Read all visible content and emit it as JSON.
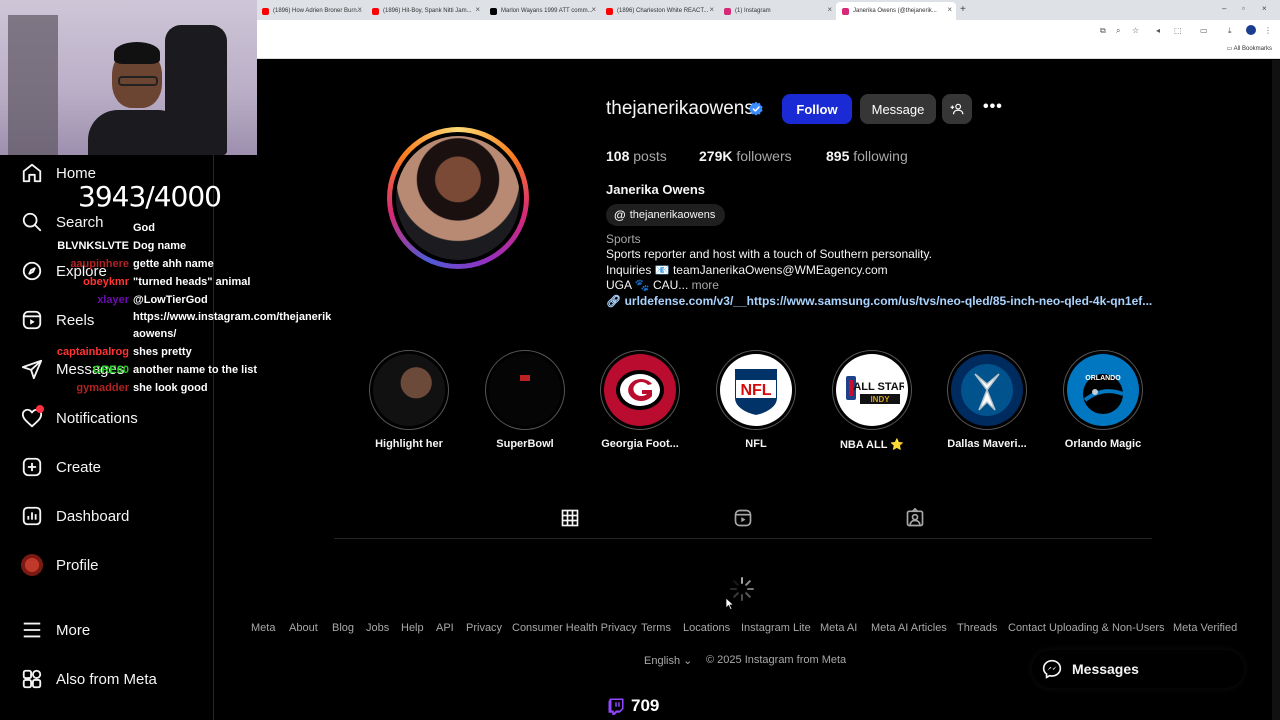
{
  "browser": {
    "tabs": [
      {
        "label": "(1896) How Adrien Broner Burn...",
        "color": "#ff0000"
      },
      {
        "label": "(1896) Hit-Boy, Spank Nitti Jam...",
        "color": "#ff0000"
      },
      {
        "label": "Marlon Wayans 1999 ATT comm...",
        "color": "#000000"
      },
      {
        "label": "(1896) Charleston White REACT...",
        "color": "#ff0000"
      },
      {
        "label": "(1) Instagram",
        "color": "#d62976"
      },
      {
        "label": "Janerika Owens (@thejanerik...",
        "color": "#d62976"
      }
    ],
    "bookmarks_label": "All Bookmarks"
  },
  "sidebar": {
    "items": [
      {
        "label": "Home",
        "icon": "home-icon"
      },
      {
        "label": "Search",
        "icon": "search-icon"
      },
      {
        "label": "Explore",
        "icon": "compass-icon"
      },
      {
        "label": "Reels",
        "icon": "reels-icon"
      },
      {
        "label": "Messages",
        "icon": "send-icon"
      },
      {
        "label": "Notifications",
        "icon": "heart-icon"
      },
      {
        "label": "Create",
        "icon": "plus-square-icon"
      },
      {
        "label": "Dashboard",
        "icon": "dashboard-icon"
      },
      {
        "label": "Profile",
        "icon": "avatar"
      },
      {
        "label": "More",
        "icon": "hamburger-icon"
      },
      {
        "label": "Also from Meta",
        "icon": "meta-apps-icon"
      }
    ]
  },
  "overlay": {
    "counter": "3943/4000",
    "chat": [
      {
        "user": "",
        "msg": "God",
        "color": "#ffffff"
      },
      {
        "user": "BLVNKSLVTE",
        "msg": "Dog name",
        "color": "#ffffff"
      },
      {
        "user": "aaupinhere",
        "msg": "gette ahh name",
        "color": "#b22222"
      },
      {
        "user": "obeykmr",
        "msg": "\"turned heads\" animal",
        "color": "#ff3333"
      },
      {
        "user": "xlayer",
        "msg": "@LowTierGod",
        "color": "#6a0dad"
      },
      {
        "user": "",
        "msg": "https://www.instagram.com/thejanerik",
        "color": "#ffffff"
      },
      {
        "user": "",
        "msg": "aowens/",
        "color": "#ffffff"
      },
      {
        "user": "captainbalrog",
        "msg": "shes pretty",
        "color": "#ff3333"
      },
      {
        "user": "GRE60",
        "msg": "another name to the list",
        "color": "#22cc22"
      },
      {
        "user": "gymadder",
        "msg": "she look good",
        "color": "#b22222"
      }
    ],
    "twitch_count": "709"
  },
  "profile": {
    "username": "thejanerikaowens",
    "follow_label": "Follow",
    "message_label": "Message",
    "stats": {
      "posts_num": "108",
      "posts_label": "posts",
      "followers_num": "279K",
      "followers_label": "followers",
      "following_num": "895",
      "following_label": "following"
    },
    "full_name": "Janerika Owens",
    "threads_handle": "thejanerikaowens",
    "category": "Sports",
    "bio_lines": [
      "Sports reporter and host with a touch of Southern personality.",
      "Inquiries 📧 teamJanerikaOwens@WMEagency.com",
      "UGA 🐾 CAU..."
    ],
    "bio_more": "more",
    "link": "urldefense.com/v3/__https://www.samsung.com/us/tvs/neo-qled/85-inch-neo-qled-4k-qn1ef..."
  },
  "highlights": [
    {
      "name": "Highlight her"
    },
    {
      "name": "SuperBowl"
    },
    {
      "name": "Georgia Foot..."
    },
    {
      "name": "NFL"
    },
    {
      "name": "NBA ALL ⭐"
    },
    {
      "name": "Dallas Maveri..."
    },
    {
      "name": "Orlando Magic"
    }
  ],
  "highlight_art": {
    "nfl_text": "NFL",
    "allstar_text": "ALL STAR",
    "indy_text": "INDY",
    "orlando_text": "ORLANDO"
  },
  "footer": {
    "links": [
      "Meta",
      "About",
      "Blog",
      "Jobs",
      "Help",
      "API",
      "Privacy",
      "Consumer Health Privacy",
      "Terms",
      "Locations",
      "Instagram Lite",
      "Meta AI",
      "Meta AI Articles",
      "Threads",
      "Contact Uploading & Non-Users",
      "Meta Verified"
    ],
    "language": "English",
    "copyright": "© 2025 Instagram from Meta"
  },
  "messages_pill": "Messages",
  "colors": {
    "follow_button": "#1a2bd6",
    "verified": "#0095f6",
    "link": "#aad4ff",
    "notification_dot": "#ff3040"
  }
}
